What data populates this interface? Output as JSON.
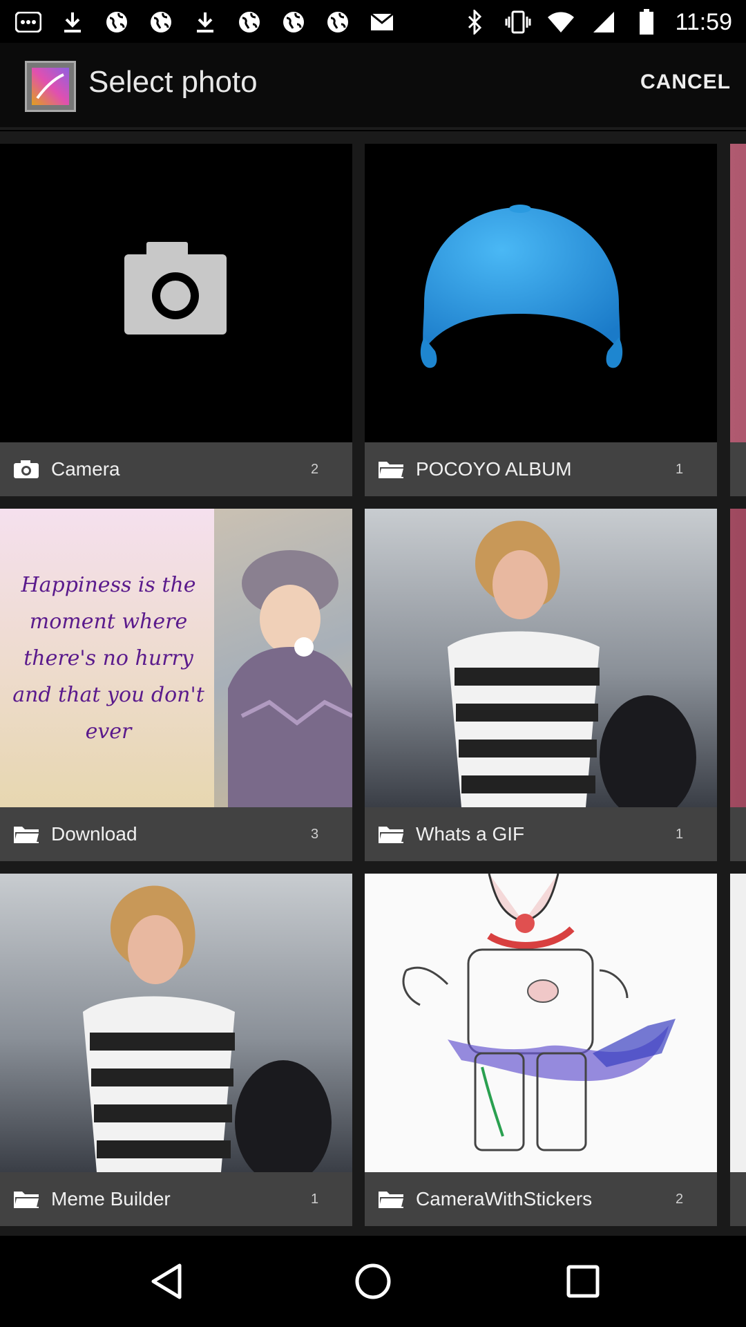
{
  "status_bar": {
    "time": "11:59",
    "left_icons": [
      "notification-icon",
      "download-icon",
      "globe-icon",
      "globe-icon",
      "download-icon",
      "globe-icon",
      "globe-icon",
      "globe-icon",
      "mail-icon"
    ],
    "right_icons": [
      "bluetooth-icon",
      "vibrate-icon",
      "wifi-icon",
      "signal-icon",
      "battery-icon"
    ]
  },
  "action_bar": {
    "title": "Select photo",
    "cancel_label": "CANCEL"
  },
  "albums": [
    {
      "name": "Camera",
      "count": "2",
      "icon": "camera-icon"
    },
    {
      "name": "POCOYO ALBUM",
      "count": "1",
      "icon": "folder-icon"
    },
    {
      "name": "Download",
      "count": "3",
      "icon": "folder-icon"
    },
    {
      "name": "Whats a GIF",
      "count": "1",
      "icon": "folder-icon"
    },
    {
      "name": "Meme Builder",
      "count": "1",
      "icon": "folder-icon"
    },
    {
      "name": "CameraWithStickers",
      "count": "2",
      "icon": "folder-icon"
    }
  ],
  "quote_text": "Happiness is the moment where there's no hurry and that you don't ever",
  "colors": {
    "label_bg": "#464646",
    "hat": "#2a9ae0",
    "quote_text": "#5a1a8c"
  },
  "nav_bar": {
    "buttons": [
      "back-icon",
      "home-icon",
      "recents-icon"
    ]
  }
}
